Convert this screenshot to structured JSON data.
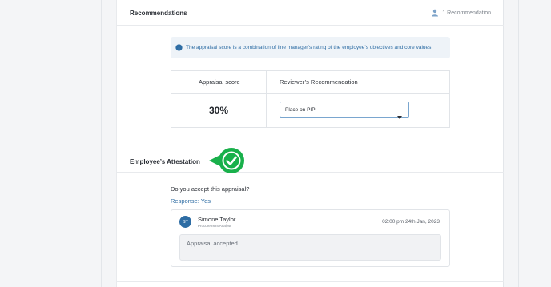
{
  "recommendations": {
    "title": "Recommendations",
    "count_label": "1 Recommendation",
    "info_text": "The appraisal score is a combination of line manager’s rating of the employee’s objectives and core values.",
    "table": {
      "col_score": "Appraisal score",
      "col_recommendation": "Reviewer’s Recommendation",
      "score_value": "30%",
      "recommendation_value": "Place on PIP"
    }
  },
  "attestation": {
    "title": "Employee’s Attestation",
    "question": "Do you accept this appraisal?",
    "response": "Response: Yes",
    "comment": {
      "initials": "ST",
      "name": "Simone Taylor",
      "role": "Procurement Analyst",
      "time": "02:00 pm  24th Jan, 2023",
      "text": "Appraisal accepted."
    }
  },
  "colors": {
    "accent_blue": "#2e6da4",
    "check_green": "#19b04b"
  },
  "icons": [
    "user-icon",
    "info-icon",
    "chevron-down-icon",
    "check-circle-icon"
  ]
}
